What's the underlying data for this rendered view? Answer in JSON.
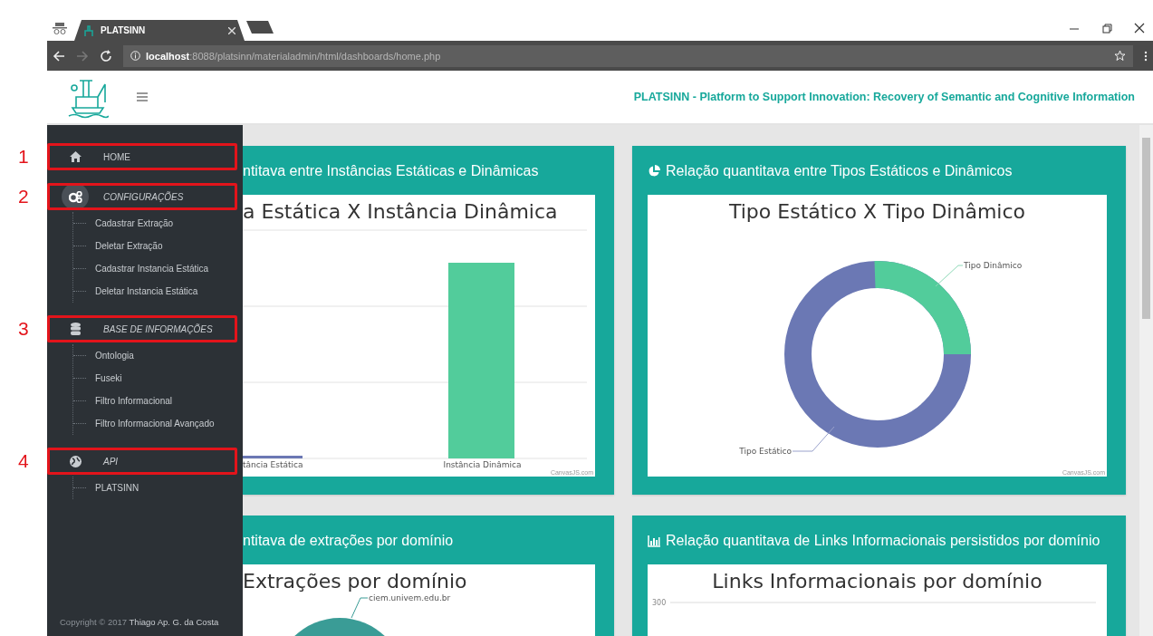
{
  "browser": {
    "tab_title": "PLATSINN",
    "url_host": "localhost",
    "url_rest": ":8088/platsinn/materialadmin/html/dashboards/home.php"
  },
  "header": {
    "title": "PLATSINN - Platform to Support Innovation: Recovery of Semantic and Cognitive Information"
  },
  "sidebar": {
    "items": [
      {
        "label": "HOME",
        "italic": false,
        "active": false,
        "callout": "1"
      },
      {
        "label": "CONFIGURAÇÕES",
        "italic": true,
        "active": true,
        "callout": "2",
        "children": [
          {
            "label": "Cadastrar Extração"
          },
          {
            "label": "Deletar Extração"
          },
          {
            "label": "Cadastrar Instancia Estática"
          },
          {
            "label": "Deletar Instancia Estática"
          }
        ]
      },
      {
        "label": "BASE DE INFORMAÇÕES",
        "italic": true,
        "active": false,
        "callout": "3",
        "children": [
          {
            "label": "Ontologia"
          },
          {
            "label": "Fuseki"
          },
          {
            "label": "Filtro Informacional"
          },
          {
            "label": "Filtro Informacional Avançado"
          }
        ]
      },
      {
        "label": "API",
        "italic": true,
        "active": false,
        "callout": "4",
        "children": [
          {
            "label": "PLATSINN"
          }
        ]
      }
    ],
    "copyright": "Copyright © 2017",
    "author": "Thiago Ap. G. da Costa"
  },
  "cards": [
    {
      "kind": "bar",
      "title": "ntitava entre Instâncias Estáticas e Dinâmicas",
      "chart_title": "a Estática X Instância Dinâmica",
      "labels": [
        "tância Estática",
        "Instância Dinâmica"
      ],
      "credit": "CanvasJS.com"
    },
    {
      "kind": "donut",
      "title": "Relação quantitava entre Tipos Estáticos e Dinâmicos",
      "chart_title": "Tipo Estático X Tipo Dinâmico",
      "labels": [
        "Tipo Dinâmico",
        "Tipo Estático"
      ],
      "credit": "CanvasJS.com"
    },
    {
      "kind": "pie",
      "title": "ntitava de extrações por domínio",
      "chart_title": "Extrações por domínio",
      "labels": [
        "ciem.univem.edu.br"
      ]
    },
    {
      "kind": "column",
      "title": "Relação quantitava de Links Informacionais persistidos por domínio",
      "chart_title": "Links Informacionais por domínio",
      "labels": [
        "300"
      ]
    }
  ]
}
